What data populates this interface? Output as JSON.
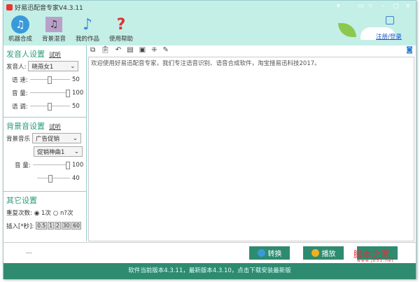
{
  "window": {
    "title": "好易迅配音专家V4.3.11",
    "controls": [
      "▾",
      "▭",
      "▿",
      "–",
      "□",
      "×"
    ]
  },
  "toolbar": [
    {
      "label": "机器合成",
      "icon": "music-note-icon"
    },
    {
      "label": "背景混音",
      "icon": "mixer-icon"
    },
    {
      "label": "我的作品",
      "icon": "works-icon"
    },
    {
      "label": "使用帮助",
      "icon": "help-icon"
    }
  ],
  "account": {
    "login": "注册/登录"
  },
  "voice": {
    "title": "发音人设置",
    "preview": "试听",
    "speaker_label": "发音人:",
    "speaker": "晓燕女1",
    "speed_label": "语 速:",
    "speed": "50",
    "volume_label": "音 量:",
    "volume": "100",
    "pitch_label": "语 调:",
    "pitch": "50"
  },
  "bgm": {
    "title": "背景音设置",
    "preview": "试听",
    "music_label": "背景音乐",
    "category": "广告促销",
    "track": "促销神曲1",
    "volume_label": "音 量:",
    "volume": "100",
    "second": "40"
  },
  "other": {
    "title": "其它设置",
    "repeat_label": "重复次数:",
    "opt1": "1次",
    "opt2": "n?次",
    "insert_label": "插入[*秒]:",
    "inserts": [
      "0.5",
      "1",
      "2",
      "30",
      "60"
    ]
  },
  "editor": {
    "text": "欢迎使用好易迅配音专家，我们专注语音识别、语音合成软件，淘宝搜易迅科技2017。"
  },
  "bottom": {
    "ellipsis": "...",
    "convert": "转换",
    "play": "播放",
    "watermark": "脚本之家",
    "watermark_url": "www.jb51.net"
  },
  "status": "软件当前版本4.3.11，最新版本4.3.10，点击下载安装最新版"
}
